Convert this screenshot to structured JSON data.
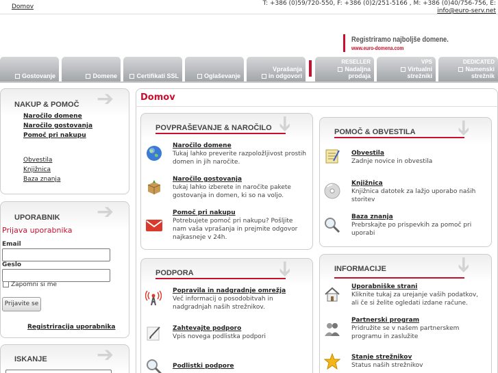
{
  "topbar": {
    "home": "Domov",
    "contact_line1": "T: +386 (0)59/720-550, F: +386 (0)2/251-5166 ,  M: +386 (0)40/756-756, E:",
    "email": "info@euro-serv.net"
  },
  "banner": {
    "title": "Registriramo najboljše domene.",
    "url": "www.euro-domena.com"
  },
  "nav": {
    "tabs": [
      {
        "label": "Gostovanje"
      },
      {
        "label": "Domene"
      },
      {
        "label": "Certifikati SSL"
      },
      {
        "label": "Oglaševanje"
      },
      {
        "label_top": "Vprašanja",
        "label": "in odgovori"
      },
      {
        "top": "RESELLER",
        "label": "Nadaljna prodaja"
      },
      {
        "top": "VPS",
        "label": "Virtualni strežniki"
      },
      {
        "top": "DEDICATED",
        "label": "Namenski strežnik"
      }
    ]
  },
  "sidebar": {
    "nakup": {
      "heading": "NAKUP & POMOČ",
      "bold_links": [
        "Naročilo domene",
        "Naročilo gostovanja",
        "Pomoč pri nakupu"
      ],
      "links": [
        "Obvestila",
        "Knjižnica",
        "Baza znanja"
      ]
    },
    "user": {
      "heading": "UPORABNIK",
      "title": "Prijava uporabnika",
      "email_label": "Email",
      "password_label": "Geslo",
      "remember_label": "Zapomni si me",
      "login_button": "Prijavite se",
      "register_link": "Registriracija uporabnika"
    },
    "search": {
      "heading": "ISKANJE"
    }
  },
  "main": {
    "title": "Domov",
    "sections": {
      "povprasevanje": {
        "heading": "POVPRAŠEVANJE & NAROČILO",
        "items": [
          {
            "title": "Naročilo domene",
            "desc": "Tukaj lahko preverite razpoložljivost prostih domen in jih naročite.",
            "icon": "globe-icon"
          },
          {
            "title": "Naročilo gostovanja",
            "desc": "tukaj lahko izberete in naročite pakete gostovanja in domen, ki so na voljo.",
            "icon": "package-icon"
          },
          {
            "title": "Pomoč pri nakupu",
            "desc": "Potrebujete pomoč pri nakupu? Pošljite nam vaša vprašanja in prejmite odgovor najkasneje v 24h.",
            "icon": "mail-icon"
          }
        ]
      },
      "pomoc": {
        "heading": "POMOČ & OBVESTILA",
        "items": [
          {
            "title": "Obvestila",
            "desc": "Zadnje novice in obvestila",
            "icon": "notepad-icon"
          },
          {
            "title": "Knjižnica",
            "desc": "Knjižnica datotek za lažjo uporabo naših storitev",
            "icon": "disc-icon"
          },
          {
            "title": "Baza znanja",
            "desc": "Prebrskajte po prispevkih za pomoč pri uporabi",
            "icon": "magnifier-icon"
          }
        ]
      },
      "podpora": {
        "heading": "PODPORA",
        "items": [
          {
            "title": "Popravila in nadgradnje omrežja",
            "desc": "Več informacij o posodobitvah in nadgradnjah naših strežnikov.",
            "icon": "antenna-icon"
          },
          {
            "title": "Zahtevajte podporo",
            "desc": "Vpis novega podlistka podpori",
            "icon": "pen-icon"
          },
          {
            "title": "Podlistki podpore",
            "desc": "",
            "icon": "magnifier-icon"
          }
        ]
      },
      "informacije": {
        "heading": "INFORMACIJE",
        "items": [
          {
            "title": "Uporabniške strani",
            "desc": "Kliknite tukaj za urejanje vaših podatkov, ali če si želite ogledati izdane račune.",
            "icon": "house-icon"
          },
          {
            "title": "Partnerski program",
            "desc": "Pridružite se v našem partnerskem programu in zaslužite",
            "icon": "people-icon"
          },
          {
            "title": "Stanje strežnikov",
            "desc": "Status naših strežnikov",
            "icon": "star-icon"
          }
        ]
      }
    }
  },
  "colors": {
    "accent": "#c8102e",
    "tab_top": "#d4d6d8",
    "tab_bottom": "#a3a6a9"
  }
}
